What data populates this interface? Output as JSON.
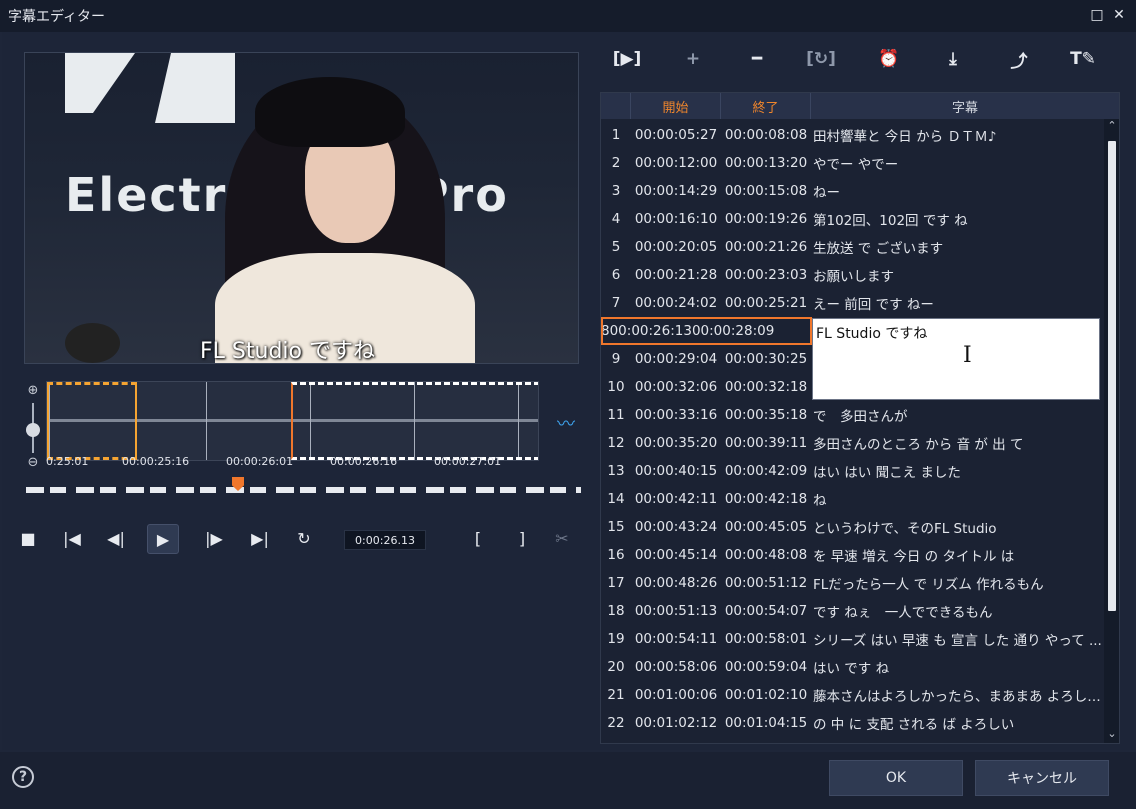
{
  "window": {
    "title": "字幕エディター",
    "maximize_icon": "maximize-icon",
    "close_icon": "close-icon"
  },
  "preview": {
    "banner_text": "Electric  und  Pro",
    "subtitle_overlay": "FL Studio ですね"
  },
  "timeline": {
    "ticks": [
      "0:25:01",
      "00:00:25:16",
      "00:00:26:01",
      "00:00:26:16",
      "00:00:27:01"
    ],
    "timecode": "0:00:26.13"
  },
  "toolbar": {
    "items": [
      {
        "name": "play-subtitle-icon",
        "glyph": "[▶]"
      },
      {
        "name": "add-icon",
        "glyph": "+"
      },
      {
        "name": "remove-icon",
        "glyph": "━"
      },
      {
        "name": "merge-icon",
        "glyph": "[↻]"
      },
      {
        "name": "time-offset-icon",
        "glyph": "⏰"
      },
      {
        "name": "import-icon",
        "glyph": "⤓"
      },
      {
        "name": "export-icon",
        "glyph": "⤴"
      },
      {
        "name": "text-style-icon",
        "glyph": "T✎"
      }
    ]
  },
  "table": {
    "headers": {
      "start": "開始",
      "end": "終了",
      "text": "字幕"
    },
    "rows": [
      {
        "num": "1",
        "start": "00:00:05:27",
        "end": "00:00:08:08",
        "text": "田村響華と 今日 から ＤＴＭ♪"
      },
      {
        "num": "2",
        "start": "00:00:12:00",
        "end": "00:00:13:20",
        "text": "やでー やでー"
      },
      {
        "num": "3",
        "start": "00:00:14:29",
        "end": "00:00:15:08",
        "text": "ねー"
      },
      {
        "num": "4",
        "start": "00:00:16:10",
        "end": "00:00:19:26",
        "text": "第102回、102回 です ね"
      },
      {
        "num": "5",
        "start": "00:00:20:05",
        "end": "00:00:21:26",
        "text": "生放送 で ございます"
      },
      {
        "num": "6",
        "start": "00:00:21:28",
        "end": "00:00:23:03",
        "text": "お願いします"
      },
      {
        "num": "7",
        "start": "00:00:24:02",
        "end": "00:00:25:21",
        "text": "えー 前回 です ねー"
      },
      {
        "num": "8",
        "start": "00:00:26:13",
        "end": "00:00:28:09",
        "text": ""
      },
      {
        "num": "9",
        "start": "00:00:29:04",
        "end": "00:00:30:25",
        "text": ""
      },
      {
        "num": "10",
        "start": "00:00:32:06",
        "end": "00:00:32:18",
        "text": ""
      },
      {
        "num": "11",
        "start": "00:00:33:16",
        "end": "00:00:35:18",
        "text": "で　多田さんが"
      },
      {
        "num": "12",
        "start": "00:00:35:20",
        "end": "00:00:39:11",
        "text": "多田さんのところ から 音 が 出 て"
      },
      {
        "num": "13",
        "start": "00:00:40:15",
        "end": "00:00:42:09",
        "text": "はい はい 聞こえ ました"
      },
      {
        "num": "14",
        "start": "00:00:42:11",
        "end": "00:00:42:18",
        "text": "ね"
      },
      {
        "num": "15",
        "start": "00:00:43:24",
        "end": "00:00:45:05",
        "text": "というわけで、そのFL Studio"
      },
      {
        "num": "16",
        "start": "00:00:45:14",
        "end": "00:00:48:08",
        "text": "を 早速 増え 今日 の タイトル は"
      },
      {
        "num": "17",
        "start": "00:00:48:26",
        "end": "00:00:51:12",
        "text": "FLだったら一人 で リズム 作れるもん"
      },
      {
        "num": "18",
        "start": "00:00:51:13",
        "end": "00:00:54:07",
        "text": "です ねぇ　一人でできるもん"
      },
      {
        "num": "19",
        "start": "00:00:54:11",
        "end": "00:00:58:01",
        "text": "シリーズ はい 早速 も 宣言 した 通り やって ..."
      },
      {
        "num": "20",
        "start": "00:00:58:06",
        "end": "00:00:59:04",
        "text": "はい です ね"
      },
      {
        "num": "21",
        "start": "00:01:00:06",
        "end": "00:01:02:10",
        "text": "藤本さんはよろしかったら、まあまあ よろしか..."
      },
      {
        "num": "22",
        "start": "00:01:02:12",
        "end": "00:01:04:15",
        "text": "の 中 に 支配 される ば よろしい"
      }
    ],
    "edit_value": "FL Studio ですね"
  },
  "footer": {
    "ok_label": "OK",
    "cancel_label": "キャンセル",
    "help_glyph": "?"
  },
  "colors": {
    "accent": "#f0772c",
    "selection_left": "#f5a432",
    "background": "#1e2639"
  }
}
